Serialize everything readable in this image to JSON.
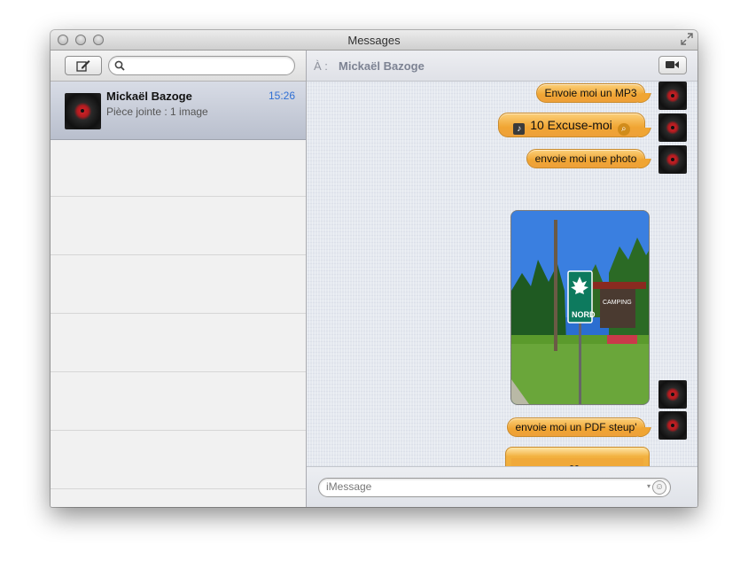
{
  "window": {
    "title": "Messages"
  },
  "sidebar": {
    "search_placeholder": "",
    "conversations": [
      {
        "name": "Mickaël Bazoge",
        "time": "15:26",
        "preview": "Pièce jointe : 1 image"
      }
    ]
  },
  "chat": {
    "to_label": "À :",
    "recipient": "Mickaël Bazoge",
    "messages": [
      {
        "type": "text",
        "text": "Envoie moi un MP3"
      },
      {
        "type": "audio-attachment",
        "text": "10 Excuse-moi"
      },
      {
        "type": "text",
        "text": "envoie moi une photo"
      },
      {
        "type": "image-attachment",
        "sign_text": "NORD",
        "sign_text_2": "CAMPING"
      },
      {
        "type": "text",
        "text": "envoie moi un PDF steup'"
      },
      {
        "type": "pdf-attachment"
      }
    ],
    "input_placeholder": "iMessage"
  },
  "colors": {
    "bubble": "#f0a533",
    "selection": "#c5cad6",
    "time": "#2f6fd4"
  }
}
